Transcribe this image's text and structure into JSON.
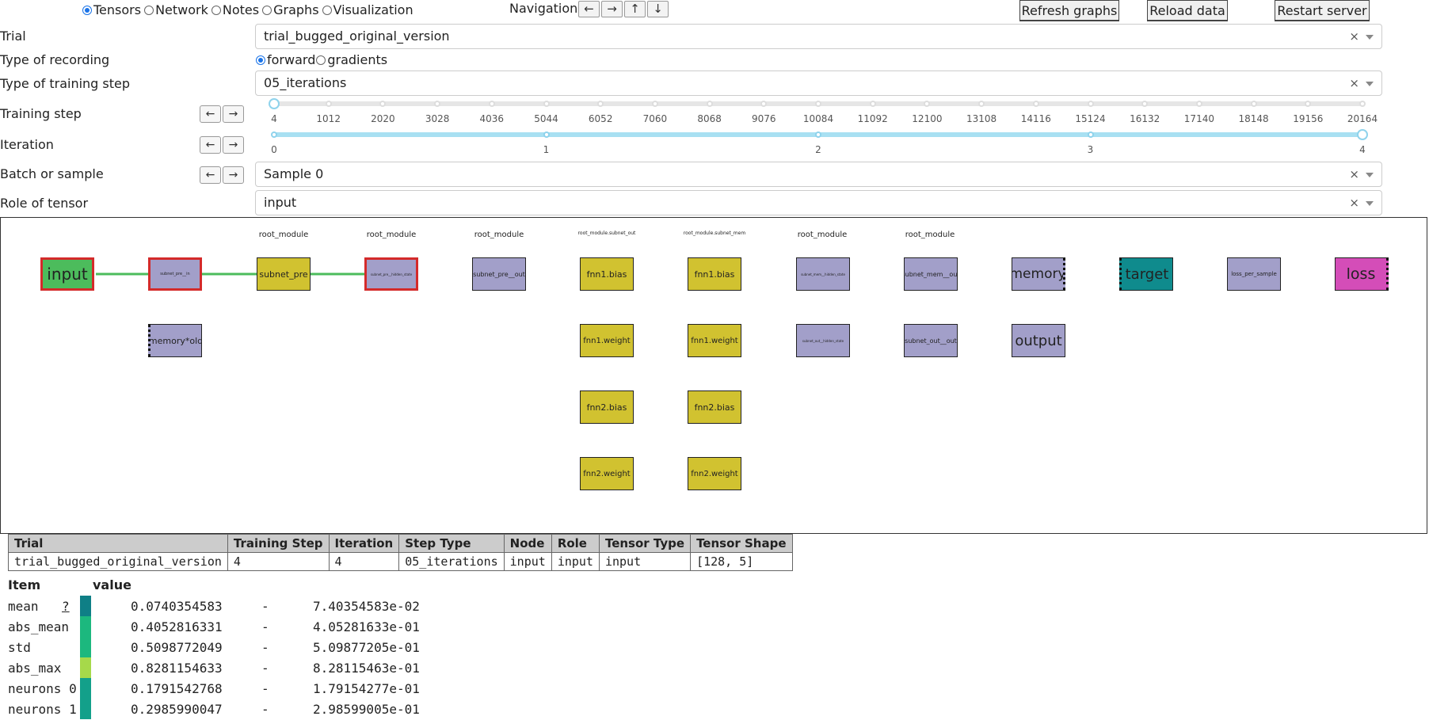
{
  "top": {
    "radios": [
      {
        "label": "Tensors",
        "checked": true
      },
      {
        "label": "Network",
        "checked": false
      },
      {
        "label": "Notes",
        "checked": false
      },
      {
        "label": "Graphs",
        "checked": false
      },
      {
        "label": "Visualization",
        "checked": false
      }
    ],
    "navigation_label": "Navigation:",
    "nav_arrows": [
      "←",
      "→",
      "↑",
      "↓"
    ],
    "refresh_label": "Refresh graphs",
    "reload_label": "Reload data",
    "restart_label": "Restart server"
  },
  "form": {
    "trial_label": "Trial",
    "trial_value": "trial_bugged_original_version",
    "recording_label": "Type of recording",
    "recording_options": [
      "forward",
      "gradients"
    ],
    "recording_selected": "forward",
    "training_step_type_label": "Type of training step",
    "training_step_type_value": "05_iterations",
    "training_step_label": "Training step",
    "iteration_label": "Iteration",
    "batch_label": "Batch or sample",
    "batch_value": "Sample 0",
    "role_label": "Role of tensor",
    "role_value": "input",
    "clear_symbol": "×",
    "left_arrow": "←",
    "right_arrow": "→"
  },
  "sliders": {
    "training_step_ticks": [
      "4",
      "1012",
      "2020",
      "3028",
      "4036",
      "5044",
      "6052",
      "7060",
      "8068",
      "9076",
      "10084",
      "11092",
      "12100",
      "13108",
      "14116",
      "15124",
      "16132",
      "17140",
      "18148",
      "19156",
      "20164"
    ],
    "training_step_value": 4,
    "iteration_ticks": [
      "0",
      "1",
      "2",
      "3",
      "4"
    ],
    "iteration_value": 4
  },
  "graph": {
    "column_labels": [
      "root_module",
      "root_module",
      "root_module",
      "root_module.subnet_out",
      "root_module.subnet_mem",
      "root_module",
      "root_module"
    ],
    "nodes": {
      "input": "input",
      "subnet_pre_in": "subnet_pre__in",
      "memory_old": "memory*old",
      "subnet_pre": "subnet_pre",
      "subnet_pre_hidden": "subnet_pre__hidden_state",
      "subnet_pre_out": "subnet_pre__out",
      "fnn1_bias_a": "fnn1.bias",
      "fnn1_weight_a": "fnn1.weight",
      "fnn2_bias_a": "fnn2.bias",
      "fnn2_weight_a": "fnn2.weight",
      "fnn1_bias_b": "fnn1.bias",
      "fnn1_weight_b": "fnn1.weight",
      "fnn2_bias_b": "fnn2.bias",
      "fnn2_weight_b": "fnn2.weight",
      "subnet_mem_hidden": "subnet_mem__hidden_state",
      "subnet_out_hidden": "subnet_out__hidden_state",
      "subnet_mem_out": "subnet_mem__out",
      "subnet_out_out": "subnet_out__out",
      "memory": "memory",
      "output": "output",
      "target": "target",
      "loss_per_sample": "loss_per_sample",
      "loss": "loss"
    },
    "colors": {
      "purple": "#a29fc9",
      "yellow": "#d1c230",
      "green": "#4cbc5c",
      "teal": "#0f8b8d",
      "magenta": "#d44db8",
      "highlight": "#d42a2a"
    }
  },
  "info_table": {
    "headers": [
      "Trial",
      "Training Step",
      "Iteration",
      "Step Type",
      "Node",
      "Role",
      "Tensor Type",
      "Tensor Shape"
    ],
    "row": [
      "trial_bugged_original_version",
      "4",
      "4",
      "05_iterations",
      "input",
      "input",
      "input",
      "[128, 5]"
    ]
  },
  "stats": {
    "item_header": "Item",
    "value_header": "value",
    "help": "?",
    "rows": [
      {
        "name": "mean",
        "value": "0.0740354583",
        "sep": "-",
        "sci": "7.40354583e-02",
        "color": "#0f7f86"
      },
      {
        "name": "abs_mean",
        "value": "0.4052816331",
        "sep": "-",
        "sci": "4.05281633e-01",
        "color": "#1cb87e"
      },
      {
        "name": "std",
        "value": "0.5098772049",
        "sep": "-",
        "sci": "5.09877205e-01",
        "color": "#1cb87e"
      },
      {
        "name": "abs_max",
        "value": "0.8281154633",
        "sep": "-",
        "sci": "8.28115463e-01",
        "color": "#a6d94a"
      },
      {
        "name": "neurons 0",
        "value": "0.1791542768",
        "sep": "-",
        "sci": "1.79154277e-01",
        "color": "#13a08a"
      },
      {
        "name": "neurons 1",
        "value": "0.2985990047",
        "sep": "-",
        "sci": "2.98599005e-01",
        "color": "#13a08a"
      }
    ]
  }
}
